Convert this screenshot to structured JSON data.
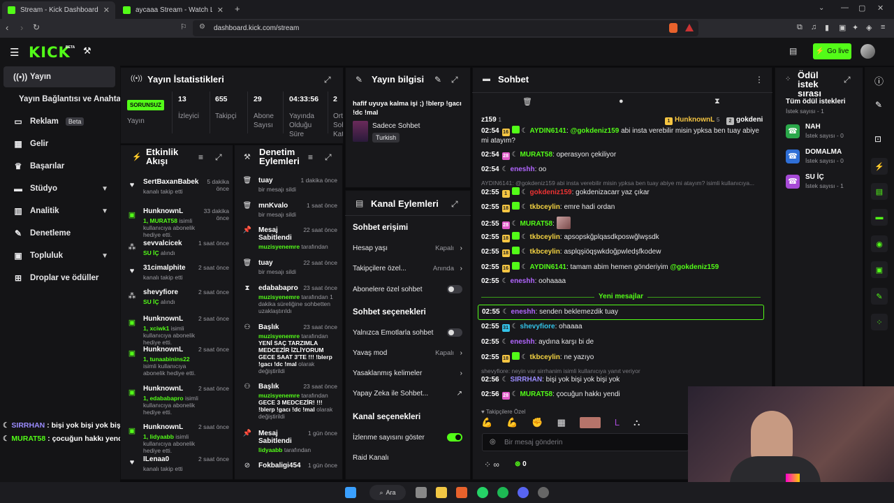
{
  "browser": {
    "tabs": [
      {
        "label": "Stream - Kick Dashboard",
        "active": true
      },
      {
        "label": "aycaaa Stream - Watch Live on K",
        "active": false
      }
    ],
    "new_tab": "+",
    "url": "dashboard.kick.com/stream"
  },
  "topbar": {
    "logo": "KICK",
    "logo_badge": "BETA",
    "go_live": "Go live"
  },
  "nav": {
    "items": [
      {
        "label": "Yayın",
        "icon": "broadcast-icon"
      },
      {
        "label": "Yayın Bağlantısı ve Anahtarı",
        "icon": ""
      },
      {
        "label": "Reklam",
        "badge": "Beta",
        "icon": "tv-icon"
      },
      {
        "label": "Gelir",
        "icon": "chart-icon"
      },
      {
        "label": "Başarılar",
        "icon": "trophy-icon"
      },
      {
        "label": "Stüdyo",
        "icon": "studio-icon"
      },
      {
        "label": "Analitik",
        "icon": "analytics-icon"
      },
      {
        "label": "Denetleme",
        "icon": "wrench-icon"
      },
      {
        "label": "Topluluk",
        "icon": "community-icon"
      },
      {
        "label": "Droplar ve ödüller",
        "icon": "gift-icon"
      }
    ]
  },
  "stats": {
    "title": "Yayın İstatistikleri",
    "status": "SORUNSUZ",
    "status_label": "Yayın",
    "cols": [
      {
        "value": "13",
        "label": "İzleyici"
      },
      {
        "value": "655",
        "label": "Takipçi"
      },
      {
        "value": "29",
        "label": "Abone Sayısı"
      },
      {
        "value": "04:33:56",
        "label": "Yayında Olduğu Süre"
      },
      {
        "value": "2",
        "label": "Ort Sohb Kat"
      }
    ]
  },
  "stream_info": {
    "title": "Yayın bilgisi",
    "stream_title": "hafif uyuya kalma işi ;) !blerp !gacı !dc !mal",
    "category": "Sadece Sohbet",
    "language": "Turkish"
  },
  "activity": {
    "title": "Etkinlik Akışı",
    "items": [
      {
        "name": "SertBaxanBabek",
        "time": "5 dakika önce",
        "sub": "kanalı takip etti",
        "hl": "",
        "icon": "heart"
      },
      {
        "name": "HunknownL",
        "time": "33 dakika önce",
        "hl": "1, MURAT58",
        "sub": " isimli kullanıcıya abonelik hediye etti.",
        "icon": "gift"
      },
      {
        "name": "sevvalcicek",
        "time": "1 saat önce",
        "hl": "SU İÇ",
        "sub": " alındı",
        "icon": "reward"
      },
      {
        "name": "31cimalphite",
        "time": "2 saat önce",
        "sub": "kanalı takip etti",
        "hl": "",
        "icon": "heart"
      },
      {
        "name": "shevyfiore",
        "time": "2 saat önce",
        "hl": "SU İÇ",
        "sub": " alındı",
        "icon": "reward"
      },
      {
        "name": "HunknownL",
        "time": "2 saat önce",
        "hl": "1, xciwk1",
        "sub": " isimli kullanıcıya abonelik hediye etti.",
        "icon": "gift"
      },
      {
        "name": "HunknownL",
        "time": "2 saat önce",
        "hl": "1, tunaabinins22",
        "sub": " isimli kullanıcıya abonelik hediye etti.",
        "icon": "gift"
      },
      {
        "name": "HunknownL",
        "time": "2 saat önce",
        "hl": "1, edababapro",
        "sub": " isimli kullanıcıya abonelik hediye etti.",
        "icon": "gift"
      },
      {
        "name": "HunknownL",
        "time": "2 saat önce",
        "hl": "1, lidyaabb",
        "sub": " isimli kullanıcıya abonelik hediye etti.",
        "icon": "gift"
      },
      {
        "name": "ILenaa0",
        "time": "2 saat önce",
        "sub": "kanalı takip etti",
        "hl": "",
        "icon": "heart"
      }
    ]
  },
  "moderation": {
    "title": "Denetim Eylemleri",
    "items": [
      {
        "name": "tuay",
        "time": "1 dakika önce",
        "hl": "",
        "sub": "bir mesajı sildi",
        "icon": "trash"
      },
      {
        "name": "mnKvalo",
        "time": "1 saat önce",
        "hl": "",
        "sub": "bir mesajı sildi",
        "icon": "trash"
      },
      {
        "name": "Mesaj Sabitlendi",
        "time": "22 saat önce",
        "hl": "muzisyenemre",
        "sub": " tarafından",
        "icon": "pin"
      },
      {
        "name": "tuay",
        "time": "22 saat önce",
        "hl": "",
        "sub": "bir mesajı sildi",
        "icon": "trash"
      },
      {
        "name": "edababapro",
        "time": "23 saat önce",
        "hl": "muzisyenemre",
        "sub": " tarafından 1 dakika süreliğine sohbetten uzaklaştırıldı",
        "icon": "hourglass"
      },
      {
        "name": "Başlık",
        "time": "23 saat önce",
        "hl": "muzisyenemre",
        "sub": " tarafından ",
        "bold": "YENİ SAÇ TARZIMLA MEDCEZİR İZLİYORUM GECE SAAT 3'TE !!! !blerp !gacı !dc !mal",
        "tail": " olarak değiştirildi",
        "icon": "users"
      },
      {
        "name": "Başlık",
        "time": "23 saat önce",
        "hl": "muzisyenemre",
        "sub": " tarafından ",
        "bold": "GECE 3 MEDCEZİR! !!! !blerp !gacı !dc !mal",
        "tail": " olarak değiştirildi",
        "icon": "users"
      },
      {
        "name": "Mesaj Sabitlendi",
        "time": "1 gün önce",
        "hl": "lidyaabb",
        "sub": " tarafından",
        "icon": "pin"
      },
      {
        "name": "Fokbaligi454",
        "time": "1 gün önce",
        "hl": "",
        "sub": "",
        "icon": "ban"
      }
    ]
  },
  "channel_actions": {
    "title": "Kanal Eylemleri",
    "chat_access": "Sohbet erişimi",
    "account_age": "Hesap yaşı",
    "account_age_val": "Kapalı",
    "followers_only": "Takipçilere özel...",
    "followers_only_val": "Anında",
    "subs_only": "Abonelere özel sohbet",
    "chat_options": "Sohbet seçenekleri",
    "emote_only": "Yalnızca Emotlarla sohbet",
    "slow_mode": "Yavaş mod",
    "slow_mode_val": "Kapalı",
    "banned_words": "Yasaklanmış kelimeler",
    "ai_chat": "Yapay Zeka ile Sohbet...",
    "channel_options": "Kanal seçenekleri",
    "show_viewers": "İzlenme sayısını göster",
    "raid": "Raid Kanalı"
  },
  "chat": {
    "title": "Sohbet",
    "pinned_user": "z159",
    "pinned_count": "1",
    "top_user1": "HunknownL",
    "top_user1_count": "5",
    "top_user2": "gokdeni",
    "messages": [
      {
        "time": "02:54",
        "badge": "16",
        "bc": "b16",
        "user": "AYDIN6141",
        "color": "#53fc18",
        "text": ": ",
        "mention": "@gokdeniz159",
        "after": " abi insta verebilir misin ypksa ben tuay abiye mi atayım?"
      },
      {
        "time": "02:54",
        "badge": "28",
        "bc": "b28",
        "user": "MURAT58",
        "color": "#53fc18",
        "text": ": operasyon çekiliyor",
        "mention": "",
        "after": ""
      },
      {
        "time": "02:54",
        "badge": "",
        "bc": "",
        "user": "eneshh",
        "color": "#b266ff",
        "text": ": oo",
        "mention": "",
        "after": ""
      }
    ],
    "reply1": "AYDIN6141: @gokdeniz159 abi insta verebilir misin ypksa ben tuay abiye mi atayım? isimli kullanıcıya...",
    "messages2": [
      {
        "time": "02:55",
        "badge": "1",
        "bc": "b16",
        "user": "gokdeniz159",
        "color": "#e33",
        "text": ": gokdenizacarr yaz çıkar",
        "mention": "",
        "after": ""
      },
      {
        "time": "02:55",
        "badge": "18",
        "bc": "b18",
        "user": "tkbceylin",
        "color": "#f5d442",
        "text": ": emre hadi ordan",
        "mention": "",
        "after": ""
      },
      {
        "time": "02:55",
        "badge": "28",
        "bc": "b28",
        "user": "MURAT58",
        "color": "#53fc18",
        "text": ": ",
        "mention": "",
        "after": ""
      },
      {
        "time": "02:55",
        "badge": "18",
        "bc": "b18",
        "user": "tkbceylin",
        "color": "#f5d442",
        "text": ": apsopskğplqasdkposwğlwşsdk",
        "mention": "",
        "after": ""
      },
      {
        "time": "02:55",
        "badge": "18",
        "bc": "b18",
        "user": "tkbceylin",
        "color": "#f5d442",
        "text": ": asplqşiöqşwkdoğpwledşfkodew",
        "mention": "",
        "after": ""
      },
      {
        "time": "02:55",
        "badge": "16",
        "bc": "b16",
        "user": "AYDIN6141",
        "color": "#53fc18",
        "text": ": tamam abim hemen gönderiyim ",
        "mention": "@gokdeniz159",
        "after": ""
      },
      {
        "time": "02:55",
        "badge": "",
        "bc": "",
        "user": "eneshh",
        "color": "#b266ff",
        "text": ": oohaaaa",
        "mention": "",
        "after": ""
      }
    ],
    "new_messages": "Yeni mesajlar",
    "messages3": [
      {
        "time": "02:55",
        "badge": "",
        "bc": "",
        "user": "eneshh",
        "color": "#b266ff",
        "text": ": senden beklemezdik tuay",
        "mention": "",
        "after": ""
      },
      {
        "time": "02:55",
        "badge": "31",
        "bc": "b31",
        "user": "shevyfiore",
        "color": "#33c3e8",
        "text": ": ohaaaa",
        "mention": "",
        "after": ""
      },
      {
        "time": "02:55",
        "badge": "",
        "bc": "",
        "user": "eneshh",
        "color": "#b266ff",
        "text": ": aydına karşı bi de",
        "mention": "",
        "after": ""
      },
      {
        "time": "02:55",
        "badge": "18",
        "bc": "b18",
        "user": "tkbceylin",
        "color": "#f5d442",
        "text": ": ne yazıyo",
        "mention": "",
        "after": ""
      }
    ],
    "reply2": "shevyfiore: neyin var sirrhanim isimli kullanıcıya yanıt veriyor",
    "messages4": [
      {
        "time": "02:56",
        "badge": "",
        "bc": "",
        "user": "SIRRHAN",
        "color": "#9b8cff",
        "text": ": bişi yok bişi yok bişi yok",
        "mention": "",
        "after": ""
      },
      {
        "time": "02:56",
        "badge": "28",
        "bc": "b28",
        "user": "MURAT58",
        "color": "#53fc18",
        "text": ": çocuğun hakkı yendi",
        "mention": "",
        "after": ""
      }
    ],
    "followers_only_label": "Takipçilere Özel",
    "input_placeholder": "Bir mesaj gönderin",
    "infinity": "∞",
    "points": "0"
  },
  "rewards": {
    "title": "Ödül istek sırası",
    "all": "Tüm ödül istekleri",
    "count": "İstek sayısı - 1",
    "items": [
      {
        "name": "NAH",
        "count": "İstek sayısı - 0",
        "color": "#2aa84a"
      },
      {
        "name": "DOMALMA",
        "count": "İstek sayısı - 0",
        "color": "#2f6fd6"
      },
      {
        "name": "SU İÇ",
        "count": "İstek sayısı - 1",
        "color": "#a64ad6"
      }
    ]
  },
  "overlay": {
    "lines": [
      {
        "user": "SIRRHAN",
        "text": " : bişi yok bişi yok bişi yok",
        "color": "#9b8cff"
      },
      {
        "user": "MURAT58",
        "text": " : çocuğun hakkı yendi",
        "color": "#53fc18"
      }
    ]
  },
  "taskbar": {
    "search": "Ara"
  },
  "colors": {
    "accent": "#53fc18",
    "panel": "#18181b",
    "background": "#0b0b0d"
  }
}
